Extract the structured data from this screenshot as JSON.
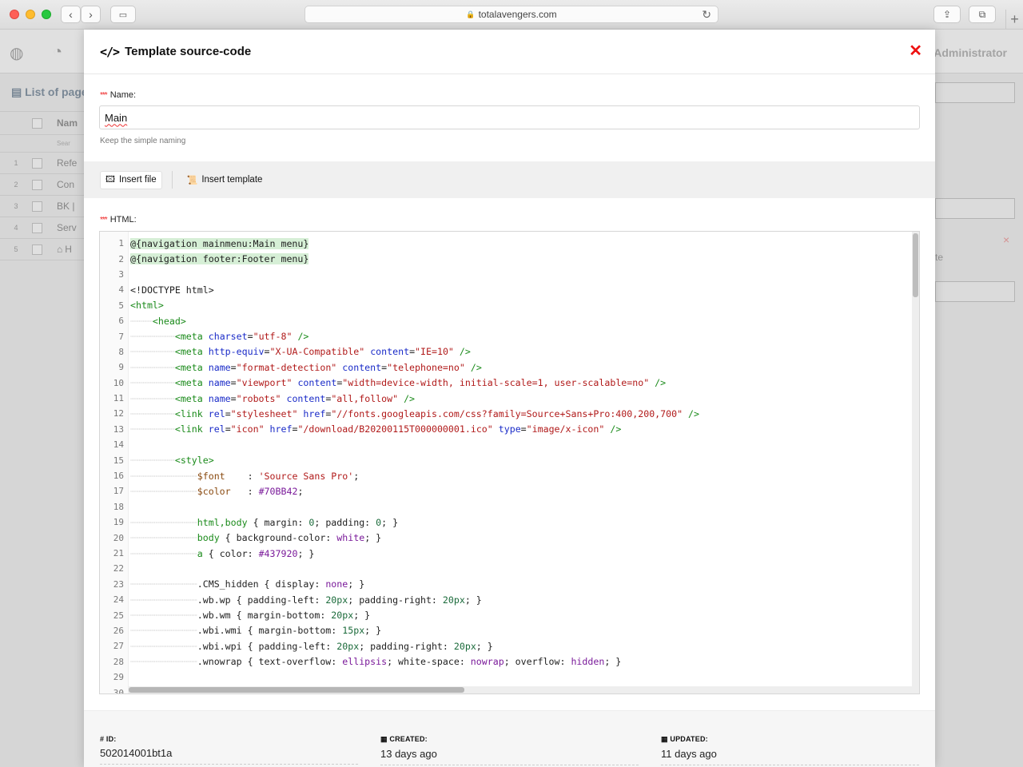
{
  "browser": {
    "url": "totalavengers.com"
  },
  "background_app": {
    "admin_label": "Administrator",
    "list_title": "List of page",
    "name_header": "Nam",
    "search_hint": "Sear",
    "rows": [
      {
        "num": "1",
        "text": "Refe"
      },
      {
        "num": "2",
        "text": "Con"
      },
      {
        "num": "3",
        "text": "BK |"
      },
      {
        "num": "4",
        "text": "Serv"
      },
      {
        "num": "5",
        "text": "H"
      }
    ],
    "right_text": "te"
  },
  "modal": {
    "title": "Template source-code",
    "name_label": "Name:",
    "name_value": "Main",
    "name_help": "Keep the simple naming",
    "required_mark": "***",
    "toolbar": {
      "insert_file": "Insert file",
      "insert_template": "Insert template"
    },
    "html_label": "HTML:",
    "footer": {
      "id_label": "# ID:",
      "id_value": "502014001bt1a",
      "created_label": "CREATED:",
      "created_value": "13 days ago",
      "updated_label": "UPDATED:",
      "updated_value": "11 days ago"
    }
  },
  "code_lines": [
    {
      "n": "1",
      "ind": 0,
      "hl": true,
      "parts": [
        [
          "t-plain",
          "@{navigation mainmenu:Main menu}"
        ]
      ]
    },
    {
      "n": "2",
      "ind": 0,
      "hl": true,
      "parts": [
        [
          "t-plain",
          "@{navigation footer:Footer menu}"
        ]
      ]
    },
    {
      "n": "3",
      "ind": 0,
      "parts": []
    },
    {
      "n": "4",
      "ind": 0,
      "parts": [
        [
          "t-plain",
          "<!DOCTYPE html>"
        ]
      ]
    },
    {
      "n": "5",
      "ind": 0,
      "parts": [
        [
          "t-tag",
          "<html>"
        ]
      ]
    },
    {
      "n": "6",
      "ind": 1,
      "parts": [
        [
          "t-tag",
          "<head>"
        ]
      ]
    },
    {
      "n": "7",
      "ind": 2,
      "parts": [
        [
          "t-tag",
          "<meta "
        ],
        [
          "t-attr",
          "charset"
        ],
        [
          "t-plain",
          "="
        ],
        [
          "t-str",
          "\"utf-8\""
        ],
        [
          "t-tag",
          " />"
        ]
      ]
    },
    {
      "n": "8",
      "ind": 2,
      "parts": [
        [
          "t-tag",
          "<meta "
        ],
        [
          "t-attr",
          "http-equiv"
        ],
        [
          "t-plain",
          "="
        ],
        [
          "t-str",
          "\"X-UA-Compatible\""
        ],
        [
          "t-plain",
          " "
        ],
        [
          "t-attr",
          "content"
        ],
        [
          "t-plain",
          "="
        ],
        [
          "t-str",
          "\"IE=10\""
        ],
        [
          "t-tag",
          " />"
        ]
      ]
    },
    {
      "n": "9",
      "ind": 2,
      "parts": [
        [
          "t-tag",
          "<meta "
        ],
        [
          "t-attr",
          "name"
        ],
        [
          "t-plain",
          "="
        ],
        [
          "t-str",
          "\"format-detection\""
        ],
        [
          "t-plain",
          " "
        ],
        [
          "t-attr",
          "content"
        ],
        [
          "t-plain",
          "="
        ],
        [
          "t-str",
          "\"telephone=no\""
        ],
        [
          "t-tag",
          " />"
        ]
      ]
    },
    {
      "n": "10",
      "ind": 2,
      "parts": [
        [
          "t-tag",
          "<meta "
        ],
        [
          "t-attr",
          "name"
        ],
        [
          "t-plain",
          "="
        ],
        [
          "t-str",
          "\"viewport\""
        ],
        [
          "t-plain",
          " "
        ],
        [
          "t-attr",
          "content"
        ],
        [
          "t-plain",
          "="
        ],
        [
          "t-str",
          "\"width=device-width, initial-scale=1, user-scalable=no\""
        ],
        [
          "t-tag",
          " />"
        ]
      ]
    },
    {
      "n": "11",
      "ind": 2,
      "parts": [
        [
          "t-tag",
          "<meta "
        ],
        [
          "t-attr",
          "name"
        ],
        [
          "t-plain",
          "="
        ],
        [
          "t-str",
          "\"robots\""
        ],
        [
          "t-plain",
          " "
        ],
        [
          "t-attr",
          "content"
        ],
        [
          "t-plain",
          "="
        ],
        [
          "t-str",
          "\"all,follow\""
        ],
        [
          "t-tag",
          " />"
        ]
      ]
    },
    {
      "n": "12",
      "ind": 2,
      "parts": [
        [
          "t-tag",
          "<link "
        ],
        [
          "t-attr",
          "rel"
        ],
        [
          "t-plain",
          "="
        ],
        [
          "t-str",
          "\"stylesheet\""
        ],
        [
          "t-plain",
          " "
        ],
        [
          "t-attr",
          "href"
        ],
        [
          "t-plain",
          "="
        ],
        [
          "t-str",
          "\"//fonts.googleapis.com/css?family=Source+Sans+Pro:400,200,700\""
        ],
        [
          "t-tag",
          " />"
        ]
      ]
    },
    {
      "n": "13",
      "ind": 2,
      "parts": [
        [
          "t-tag",
          "<link "
        ],
        [
          "t-attr",
          "rel"
        ],
        [
          "t-plain",
          "="
        ],
        [
          "t-str",
          "\"icon\""
        ],
        [
          "t-plain",
          " "
        ],
        [
          "t-attr",
          "href"
        ],
        [
          "t-plain",
          "="
        ],
        [
          "t-str",
          "\"/download/B20200115T000000001.ico\""
        ],
        [
          "t-plain",
          " "
        ],
        [
          "t-attr",
          "type"
        ],
        [
          "t-plain",
          "="
        ],
        [
          "t-str",
          "\"image/x-icon\""
        ],
        [
          "t-tag",
          " />"
        ]
      ]
    },
    {
      "n": "14",
      "ind": 0,
      "parts": []
    },
    {
      "n": "15",
      "ind": 2,
      "parts": [
        [
          "t-tag",
          "<style>"
        ]
      ]
    },
    {
      "n": "16",
      "ind": 3,
      "parts": [
        [
          "t-var",
          "$font"
        ],
        [
          "t-plain",
          "    : "
        ],
        [
          "t-str",
          "'Source Sans Pro'"
        ],
        [
          "t-plain",
          ";"
        ]
      ]
    },
    {
      "n": "17",
      "ind": 3,
      "parts": [
        [
          "t-var",
          "$color"
        ],
        [
          "t-plain",
          "   : "
        ],
        [
          "t-kw",
          "#70BB42"
        ],
        [
          "t-plain",
          ";"
        ]
      ]
    },
    {
      "n": "18",
      "ind": 0,
      "parts": []
    },
    {
      "n": "19",
      "ind": 3,
      "parts": [
        [
          "t-tag",
          "html,body"
        ],
        [
          "t-plain",
          " { margin: "
        ],
        [
          "t-num",
          "0"
        ],
        [
          "t-plain",
          "; padding: "
        ],
        [
          "t-num",
          "0"
        ],
        [
          "t-plain",
          "; }"
        ]
      ]
    },
    {
      "n": "20",
      "ind": 3,
      "parts": [
        [
          "t-tag",
          "body"
        ],
        [
          "t-plain",
          " { background-color: "
        ],
        [
          "t-kw",
          "white"
        ],
        [
          "t-plain",
          "; }"
        ]
      ]
    },
    {
      "n": "21",
      "ind": 3,
      "parts": [
        [
          "t-tag",
          "a"
        ],
        [
          "t-plain",
          " { color: "
        ],
        [
          "t-kw",
          "#437920"
        ],
        [
          "t-plain",
          "; }"
        ]
      ]
    },
    {
      "n": "22",
      "ind": 0,
      "parts": []
    },
    {
      "n": "23",
      "ind": 3,
      "parts": [
        [
          "t-plain",
          ".CMS_hidden { display: "
        ],
        [
          "t-kw",
          "none"
        ],
        [
          "t-plain",
          "; }"
        ]
      ]
    },
    {
      "n": "24",
      "ind": 3,
      "parts": [
        [
          "t-plain",
          ".wb.wp { padding-left: "
        ],
        [
          "t-num",
          "20px"
        ],
        [
          "t-plain",
          "; padding-right: "
        ],
        [
          "t-num",
          "20px"
        ],
        [
          "t-plain",
          "; }"
        ]
      ]
    },
    {
      "n": "25",
      "ind": 3,
      "parts": [
        [
          "t-plain",
          ".wb.wm { margin-bottom: "
        ],
        [
          "t-num",
          "20px"
        ],
        [
          "t-plain",
          "; }"
        ]
      ]
    },
    {
      "n": "26",
      "ind": 3,
      "parts": [
        [
          "t-plain",
          ".wbi.wmi { margin-bottom: "
        ],
        [
          "t-num",
          "15px"
        ],
        [
          "t-plain",
          "; }"
        ]
      ]
    },
    {
      "n": "27",
      "ind": 3,
      "parts": [
        [
          "t-plain",
          ".wbi.wpi { padding-left: "
        ],
        [
          "t-num",
          "20px"
        ],
        [
          "t-plain",
          "; padding-right: "
        ],
        [
          "t-num",
          "20px"
        ],
        [
          "t-plain",
          "; }"
        ]
      ]
    },
    {
      "n": "28",
      "ind": 3,
      "parts": [
        [
          "t-plain",
          ".wnowrap { text-overflow: "
        ],
        [
          "t-kw",
          "ellipsis"
        ],
        [
          "t-plain",
          "; white-space: "
        ],
        [
          "t-kw",
          "nowrap"
        ],
        [
          "t-plain",
          "; overflow: "
        ],
        [
          "t-kw",
          "hidden"
        ],
        [
          "t-plain",
          "; }"
        ]
      ]
    },
    {
      "n": "29",
      "ind": 0,
      "parts": []
    },
    {
      "n": "30",
      "ind": 0,
      "parts": []
    }
  ],
  "colors": {
    "close": "#ee1111",
    "required": "#ee2222",
    "highlight": "#d6efd6"
  }
}
